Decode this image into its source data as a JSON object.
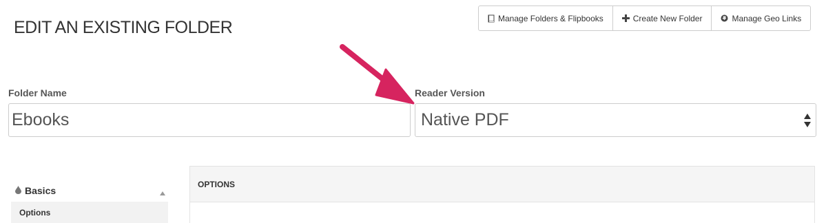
{
  "page": {
    "title": "EDIT AN EXISTING FOLDER"
  },
  "toolbar": {
    "buttons": [
      {
        "label": "Manage Folders & Flipbooks",
        "icon": "book-icon"
      },
      {
        "label": "Create New Folder",
        "icon": "plus-icon"
      },
      {
        "label": "Manage Geo Links",
        "icon": "globe-icon"
      }
    ]
  },
  "form": {
    "folder_name": {
      "label": "Folder Name",
      "value": "Ebooks"
    },
    "reader_version": {
      "label": "Reader Version",
      "selected": "Native PDF"
    }
  },
  "annotation": {
    "arrow_color": "#d6245f"
  },
  "sidebar": {
    "section": {
      "label": "Basics",
      "icon": "drop-icon"
    },
    "items": [
      {
        "label": "Options"
      }
    ]
  },
  "panel": {
    "header": "OPTIONS"
  }
}
